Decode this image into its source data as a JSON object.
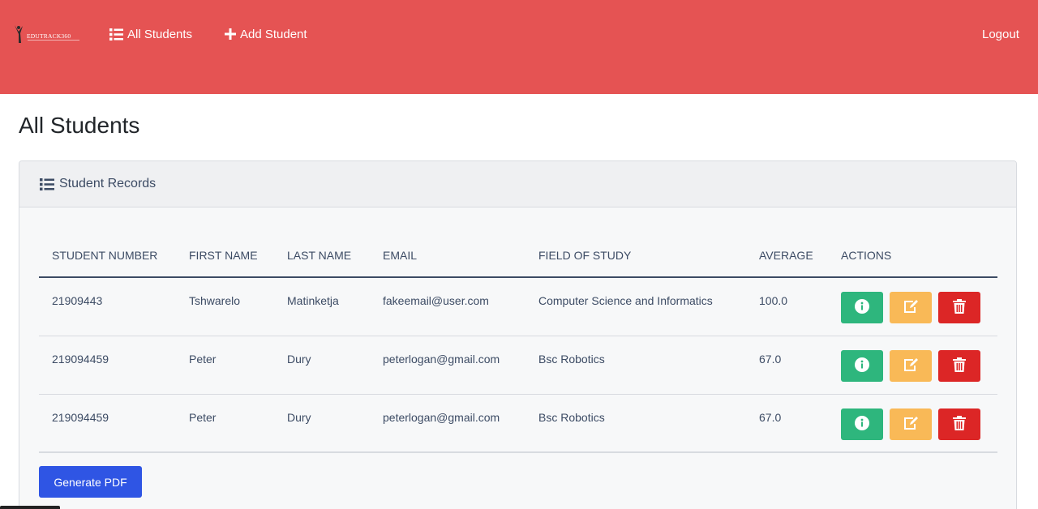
{
  "navbar": {
    "brand_text": "EDUTRACK360",
    "all_students": "All Students",
    "add_student": "Add Student",
    "logout": "Logout",
    "color": "#e55353"
  },
  "page": {
    "title": "All Students"
  },
  "card": {
    "header": "Student Records"
  },
  "table": {
    "columns": [
      "STUDENT NUMBER",
      "FIRST NAME",
      "LAST NAME",
      "EMAIL",
      "FIELD OF STUDY",
      "AVERAGE",
      "ACTIONS"
    ],
    "rows": [
      [
        "21909443",
        "Tshwarelo",
        "Matinketja",
        "fakeemail@user.com",
        "Computer Science and Informatics",
        "100.0"
      ],
      [
        "219094459",
        "Peter",
        "Dury",
        "peterlogan@gmail.com",
        "Bsc Robotics",
        "67.0"
      ],
      [
        "219094459",
        "Peter",
        "Dury",
        "peterlogan@gmail.com",
        "Bsc Robotics",
        "67.0"
      ]
    ],
    "action_icons": [
      "info-icon",
      "edit-icon",
      "trash-icon"
    ]
  },
  "buttons": {
    "generate_pdf": "Generate PDF"
  },
  "colors": {
    "info": "#2eb67d",
    "edit": "#f9b957",
    "delete": "#dc2626",
    "primary": "#2f55e4"
  }
}
